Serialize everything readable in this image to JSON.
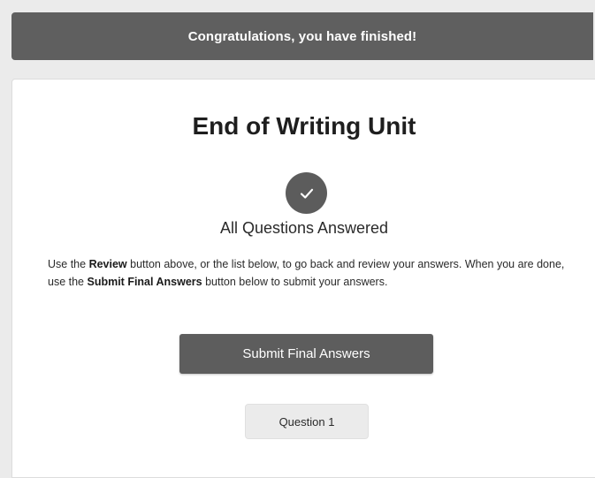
{
  "banner": {
    "message": "Congratulations, you have finished!"
  },
  "main": {
    "title": "End of Writing Unit",
    "status_icon": "checkmark-icon",
    "status_text": "All Questions Answered",
    "instructions": {
      "part1": "Use the ",
      "review_bold": "Review",
      "part2": " button above, or the list below, to go back and review your answers. When you are done, use the ",
      "submit_bold": "Submit Final Answers",
      "part3": " button below to submit your answers."
    },
    "submit_button_label": "Submit Final Answers",
    "question_list": [
      {
        "label": "Question 1"
      }
    ]
  },
  "colors": {
    "banner_bg": "#5f5f5f",
    "button_bg": "#5d5d5d",
    "page_bg": "#ebebeb"
  }
}
